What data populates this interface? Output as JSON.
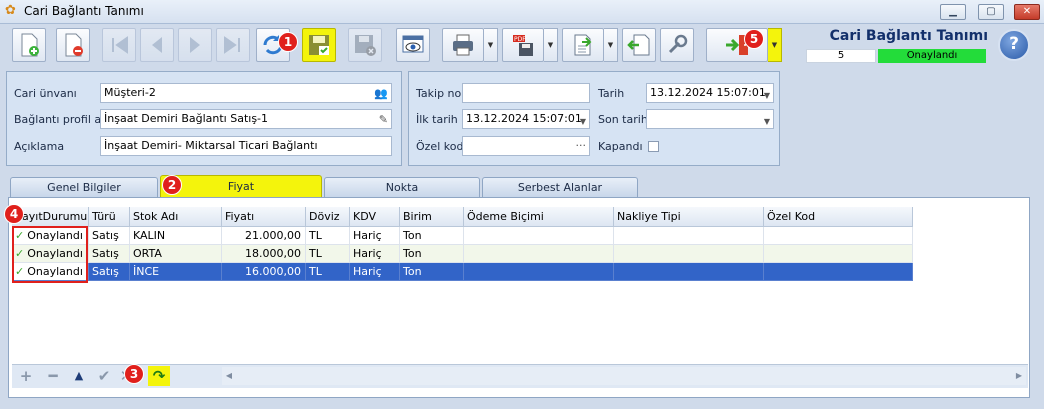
{
  "window": {
    "title": "Cari Bağlantı Tanımı",
    "controls": [
      "minimize",
      "maximize",
      "close"
    ]
  },
  "header": {
    "form_title": "Cari Bağlantı Tanımı",
    "record_no": "5",
    "status": "Onaylandı",
    "status_color": "#23dc3a",
    "highlight_color": "#f4f40c"
  },
  "annotations": [
    "1",
    "2",
    "3",
    "4",
    "5"
  ],
  "toolbar": {
    "icons": [
      "new-document-icon",
      "delete-document-icon",
      "first-record-icon",
      "previous-record-icon",
      "next-record-icon",
      "last-record-icon",
      "refresh-icon",
      "save-approve-icon",
      "save-close-icon",
      "preview-icon",
      "print-icon",
      "pdf-export-icon",
      "export-icon",
      "import-icon",
      "tools-icon",
      "exit-icon",
      "help-icon"
    ]
  },
  "form_left": {
    "cari_unvani_label": "Cari ünvanı",
    "cari_unvani_value": "Müşteri-2",
    "baglanti_profil_label": "Bağlantı profil adı",
    "baglanti_profil_value": "İnşaat Demiri Bağlantı Satış-1",
    "aciklama_label": "Açıklama",
    "aciklama_value": "İnşaat Demiri- Miktarsal Ticari Bağlantı"
  },
  "form_right": {
    "takip_no_label": "Takip no",
    "takip_no_value": "",
    "tarih_label": "Tarih",
    "tarih_value": "13.12.2024 15:07:01",
    "ilk_tarih_label": "İlk tarih",
    "ilk_tarih_value": "13.12.2024 15:07:01",
    "son_tarih_label": "Son tarih",
    "son_tarih_value": " .  .        :  :",
    "ozel_kod_label": "Özel kod",
    "ozel_kod_value": "",
    "kapandi_label": "Kapandı",
    "kapandi_checked": false
  },
  "tabs": [
    {
      "label": "Genel Bilgiler",
      "active": false
    },
    {
      "label": "Fiyat",
      "active": true
    },
    {
      "label": "Nokta",
      "active": false
    },
    {
      "label": "Serbest Alanlar",
      "active": false
    }
  ],
  "grid": {
    "columns": [
      "KayıtDurumu",
      "Türü",
      "Stok Adı",
      "Fiyatı",
      "Döviz",
      "KDV",
      "Birim",
      "Ödeme Biçimi",
      "Nakliye Tipi",
      "Özel Kod"
    ],
    "rows": [
      {
        "durum": "Onaylandı",
        "turu": "Satış",
        "stok": "KALIN",
        "fiyat": "21.000,00",
        "doviz": "TL",
        "kdv": "Hariç",
        "birim": "Ton",
        "odeme": "",
        "nakliye": "",
        "ozel": "",
        "selected": false
      },
      {
        "durum": "Onaylandı",
        "turu": "Satış",
        "stok": "ORTA",
        "fiyat": "18.000,00",
        "doviz": "TL",
        "kdv": "Hariç",
        "birim": "Ton",
        "odeme": "",
        "nakliye": "",
        "ozel": "",
        "selected": false
      },
      {
        "durum": "Onaylandı",
        "turu": "Satış",
        "stok": "İNCE",
        "fiyat": "16.000,00",
        "doviz": "TL",
        "kdv": "Hariç",
        "birim": "Ton",
        "odeme": "",
        "nakliye": "",
        "ozel": "",
        "selected": true
      }
    ]
  },
  "grid_nav": {
    "icons": [
      "add-icon",
      "remove-icon",
      "move-up-icon",
      "confirm-icon",
      "cancel-icon",
      "refresh-icon"
    ]
  }
}
